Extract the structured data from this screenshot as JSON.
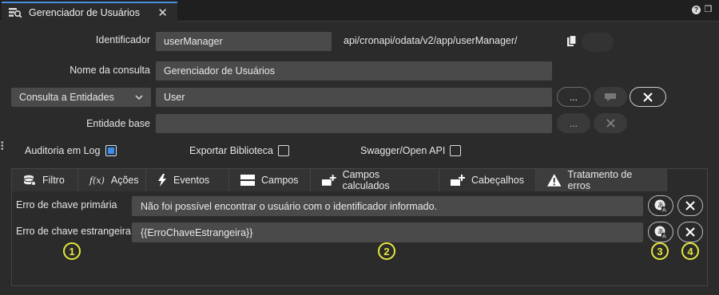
{
  "tab": {
    "title": "Gerenciador de Usuários",
    "icon": "database-search-icon"
  },
  "window_icons": {
    "help": "?"
  },
  "form": {
    "identificador_label": "Identificador",
    "identificador_value": "userManager",
    "url": "api/cronapi/odata/v2/app/userManager/",
    "nome_label": "Nome da consulta",
    "nome_value": "Gerenciador de Usuários",
    "tipo_select": "Consulta a Entidades",
    "entidade_value": "User",
    "ellipsis": "...",
    "entidade_base_label": "Entidade base",
    "entidade_base_value": ""
  },
  "options": {
    "auditoria_label": "Auditoria em Log",
    "auditoria_checked": true,
    "exportar_label": "Exportar Biblioteca",
    "exportar_checked": false,
    "swagger_label": "Swagger/Open API",
    "swagger_checked": false
  },
  "tabs": [
    {
      "label": "Filtro",
      "icon": "database-icon"
    },
    {
      "label": "Ações",
      "icon": "function-icon"
    },
    {
      "label": "Eventos",
      "icon": "lightning-icon"
    },
    {
      "label": "Campos",
      "icon": "fields-icon"
    },
    {
      "label": "Campos calculados",
      "icon": "calculated-fields-icon"
    },
    {
      "label": "Cabeçalhos",
      "icon": "headers-icon"
    },
    {
      "label": "Tratamento de erros",
      "icon": "warning-icon"
    }
  ],
  "errors": {
    "primary_label": "Erro de chave primária",
    "primary_value": "Não foi possível encontrar o usuário com o identificador informado.",
    "foreign_label": "Erro de chave estrangeira",
    "foreign_value": "{{ErroChaveEstrangeira}}"
  },
  "callouts": [
    "1",
    "2",
    "3",
    "4"
  ],
  "colors": {
    "accent": "#3b8eea",
    "callout": "#e5e83a",
    "background": "#2b2b2b"
  }
}
